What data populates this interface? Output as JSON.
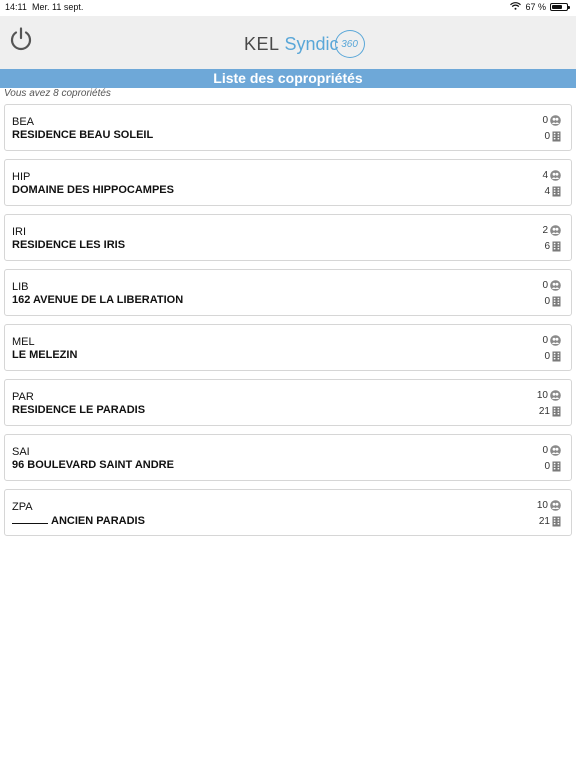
{
  "status_bar": {
    "time": "14:11",
    "date": "Mer. 11 sept.",
    "battery": "67 %"
  },
  "header": {
    "logo_kel": "KEL",
    "logo_syndic": "Syndic",
    "logo_badge": "360"
  },
  "page": {
    "title": "Liste des copropriétés",
    "count_text": "Vous avez 8 coproriétés"
  },
  "properties": [
    {
      "code": "BEA",
      "name": "RESIDENCE BEAU SOLEIL",
      "people": "0",
      "buildings": "0"
    },
    {
      "code": "HIP",
      "name": "DOMAINE DES HIPPOCAMPES",
      "people": "4",
      "buildings": "4"
    },
    {
      "code": "IRI",
      "name": "RESIDENCE LES IRIS",
      "people": "2",
      "buildings": "6"
    },
    {
      "code": "LIB",
      "name": "162 AVENUE DE LA LIBERATION",
      "people": "0",
      "buildings": "0"
    },
    {
      "code": "MEL",
      "name": "LE MELEZIN",
      "people": "0",
      "buildings": "0"
    },
    {
      "code": "PAR",
      "name": "RESIDENCE LE PARADIS",
      "people": "10",
      "buildings": "21"
    },
    {
      "code": "SAI",
      "name": "96 BOULEVARD SAINT ANDRE",
      "people": "0",
      "buildings": "0"
    },
    {
      "code": "ZPA",
      "name": "ANCIEN PARADIS",
      "people": "10",
      "buildings": "21"
    }
  ],
  "colors": {
    "title_bar": "#6ea8d8",
    "header_bg": "#efefef",
    "logo_accent": "#5aa7d8"
  },
  "icons": {
    "people": "people-icon",
    "building": "building-icon",
    "power": "power-icon",
    "wifi": "wifi-icon",
    "battery": "battery-icon"
  }
}
